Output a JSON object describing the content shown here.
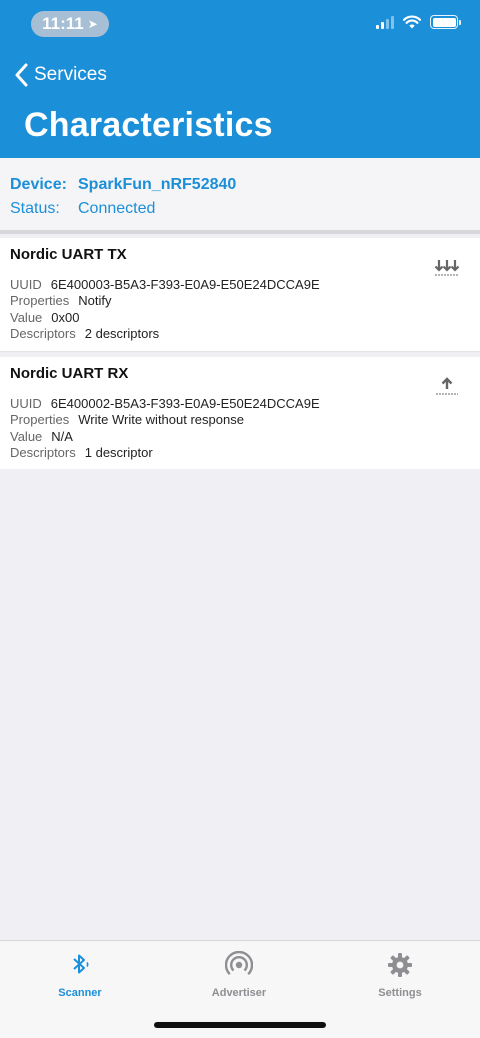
{
  "status_bar": {
    "time": "11:11",
    "location_glyph": "➤"
  },
  "nav": {
    "back_label": "Services",
    "title": "Characteristics"
  },
  "device": {
    "device_key": "Device:",
    "device_value": "SparkFun_nRF52840",
    "status_key": "Status:",
    "status_value": "Connected"
  },
  "characteristics": [
    {
      "name": "Nordic UART TX",
      "uuid_key": "UUID",
      "uuid": "6E400003-B5A3-F393-E0A9-E50E24DCCA9E",
      "properties_key": "Properties",
      "properties": "Notify",
      "value_key": "Value",
      "value": "0x00",
      "descriptors_key": "Descriptors",
      "descriptors": "2 descriptors",
      "icon": "notify-download-icon"
    },
    {
      "name": "Nordic UART RX",
      "uuid_key": "UUID",
      "uuid": "6E400002-B5A3-F393-E0A9-E50E24DCCA9E",
      "properties_key": "Properties",
      "properties": "Write Write without response",
      "value_key": "Value",
      "value": "N/A",
      "descriptors_key": "Descriptors",
      "descriptors": "1 descriptor",
      "icon": "write-upload-icon"
    }
  ],
  "tabs": [
    {
      "label": "Scanner",
      "icon": "bluetooth-icon",
      "active": true
    },
    {
      "label": "Advertiser",
      "icon": "broadcast-icon",
      "active": false
    },
    {
      "label": "Settings",
      "icon": "gear-icon",
      "active": false
    }
  ],
  "colors": {
    "accent": "#1c8fd9",
    "inactive": "#8e8e93",
    "background": "#efeff4"
  }
}
